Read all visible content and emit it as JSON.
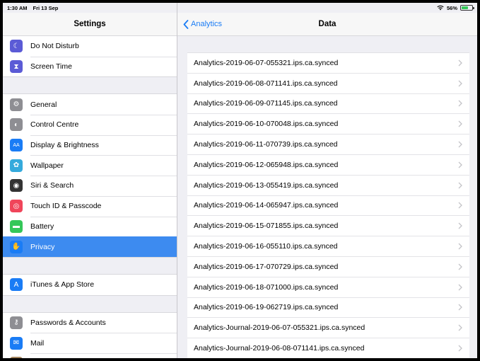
{
  "status": {
    "time": "1:30 AM",
    "date": "Fri 13 Sep",
    "battery": "56%"
  },
  "sidebar": {
    "title": "Settings",
    "groups": [
      {
        "items": [
          {
            "label": "Do Not Disturb",
            "icon": "moon-icon",
            "color": "#5b5bd6"
          },
          {
            "label": "Screen Time",
            "icon": "hourglass-icon",
            "color": "#5b5bd6"
          }
        ]
      },
      {
        "items": [
          {
            "label": "General",
            "icon": "gear-icon",
            "color": "#8e8e93"
          },
          {
            "label": "Control Centre",
            "icon": "toggles-icon",
            "color": "#8e8e93"
          },
          {
            "label": "Display & Brightness",
            "icon": "text-size-icon",
            "color": "#1a7cf5"
          },
          {
            "label": "Wallpaper",
            "icon": "flower-icon",
            "color": "#35aadc"
          },
          {
            "label": "Siri & Search",
            "icon": "siri-icon",
            "color": "#333"
          },
          {
            "label": "Touch ID & Passcode",
            "icon": "fingerprint-icon",
            "color": "#f0455a"
          },
          {
            "label": "Battery",
            "icon": "battery-icon",
            "color": "#34c759"
          },
          {
            "label": "Privacy",
            "icon": "hand-icon",
            "color": "#1a7cf5",
            "selected": true
          }
        ]
      },
      {
        "items": [
          {
            "label": "iTunes & App Store",
            "icon": "app-store-icon",
            "color": "#1a7cf5"
          }
        ]
      },
      {
        "items": [
          {
            "label": "Passwords & Accounts",
            "icon": "key-icon",
            "color": "#8e8e93"
          },
          {
            "label": "Mail",
            "icon": "mail-icon",
            "color": "#1a7cf5"
          },
          {
            "label": "Contacts",
            "icon": "contacts-icon",
            "color": "#a2845e"
          }
        ]
      }
    ]
  },
  "detail": {
    "back_label": "Analytics",
    "title": "Data",
    "rows": [
      "Analytics-2019-06-07-055321.ips.ca.synced",
      "Analytics-2019-06-08-071141.ips.ca.synced",
      "Analytics-2019-06-09-071145.ips.ca.synced",
      "Analytics-2019-06-10-070048.ips.ca.synced",
      "Analytics-2019-06-11-070739.ips.ca.synced",
      "Analytics-2019-06-12-065948.ips.ca.synced",
      "Analytics-2019-06-13-055419.ips.ca.synced",
      "Analytics-2019-06-14-065947.ips.ca.synced",
      "Analytics-2019-06-15-071855.ips.ca.synced",
      "Analytics-2019-06-16-055110.ips.ca.synced",
      "Analytics-2019-06-17-070729.ips.ca.synced",
      "Analytics-2019-06-18-071000.ips.ca.synced",
      "Analytics-2019-06-19-062719.ips.ca.synced",
      "Analytics-Journal-2019-06-07-055321.ips.ca.synced",
      "Analytics-Journal-2019-06-08-071141.ips.ca.synced"
    ]
  }
}
